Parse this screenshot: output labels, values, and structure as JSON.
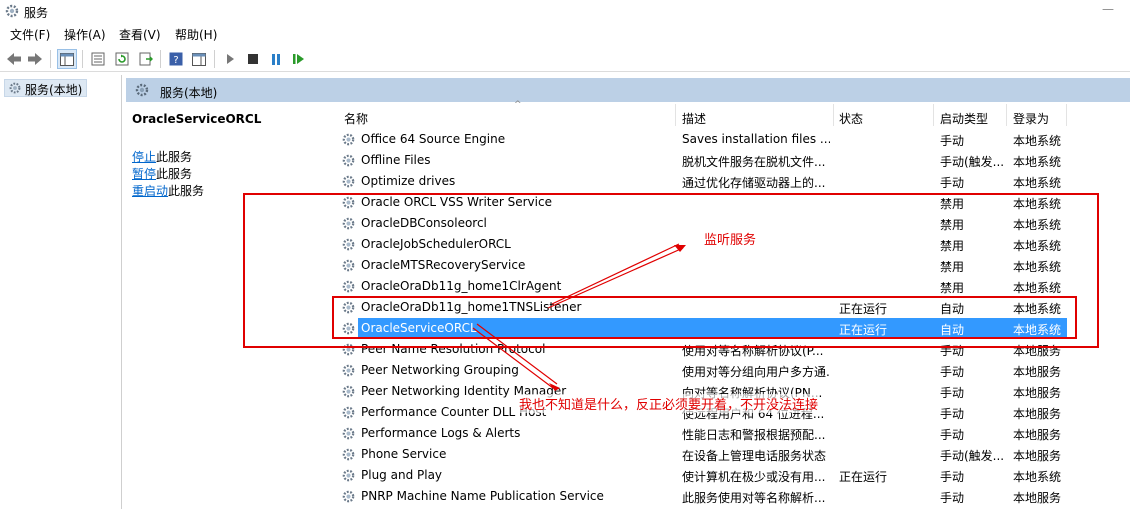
{
  "window": {
    "title": "服务"
  },
  "menu": [
    "文件(F)",
    "操作(A)",
    "查看(V)",
    "帮助(H)"
  ],
  "toolbar": {
    "buttons": [
      "back-icon",
      "forward-icon",
      "show-hide-console-tree-icon",
      "properties-icon",
      "refresh-icon",
      "export-list-icon",
      "help-icon",
      "show-hide-action-pane-icon",
      "start-service-icon",
      "stop-service-icon",
      "pause-service-icon",
      "restart-service-icon"
    ]
  },
  "tree": {
    "node_label": "服务(本地)"
  },
  "content_header": {
    "title": "服务(本地)"
  },
  "extended_panel": {
    "service_name": "OracleServiceORCL",
    "actions": [
      {
        "link": "停止",
        "rest": "此服务"
      },
      {
        "link": "暂停",
        "rest": "此服务"
      },
      {
        "link": "重启动",
        "rest": "此服务"
      }
    ]
  },
  "columns": [
    "名称",
    "描述",
    "状态",
    "启动类型",
    "登录为"
  ],
  "services": [
    {
      "name": "Office 64 Source Engine",
      "description": "Saves installation files ...",
      "status": "",
      "startup": "手动",
      "logon": "本地系统"
    },
    {
      "name": "Offline Files",
      "description": "脱机文件服务在脱机文件...",
      "status": "",
      "startup": "手动(触发...",
      "logon": "本地系统"
    },
    {
      "name": "Optimize drives",
      "description": "通过优化存储驱动器上的...",
      "status": "",
      "startup": "手动",
      "logon": "本地系统"
    },
    {
      "name": "Oracle ORCL VSS Writer Service",
      "description": "",
      "status": "",
      "startup": "禁用",
      "logon": "本地系统"
    },
    {
      "name": "OracleDBConsoleorcl",
      "description": "",
      "status": "",
      "startup": "禁用",
      "logon": "本地系统"
    },
    {
      "name": "OracleJobSchedulerORCL",
      "description": "",
      "status": "",
      "startup": "禁用",
      "logon": "本地系统"
    },
    {
      "name": "OracleMTSRecoveryService",
      "description": "",
      "status": "",
      "startup": "禁用",
      "logon": "本地系统"
    },
    {
      "name": "OracleOraDb11g_home1ClrAgent",
      "description": "",
      "status": "",
      "startup": "禁用",
      "logon": "本地系统"
    },
    {
      "name": "OracleOraDb11g_home1TNSListener",
      "description": "",
      "status": "正在运行",
      "startup": "自动",
      "logon": "本地系统"
    },
    {
      "name": "OracleServiceORCL",
      "description": "",
      "status": "正在运行",
      "startup": "自动",
      "logon": "本地系统",
      "selected": true
    },
    {
      "name": "Peer Name Resolution Protocol",
      "description": "使用对等名称解析协议(P...",
      "status": "",
      "startup": "手动",
      "logon": "本地服务"
    },
    {
      "name": "Peer Networking Grouping",
      "description": "使用对等分组向用户多方通...",
      "status": "",
      "startup": "手动",
      "logon": "本地服务"
    },
    {
      "name": "Peer Networking Identity Manager",
      "description": "向对等名称解析协议(PN...",
      "status": "",
      "startup": "手动",
      "logon": "本地服务"
    },
    {
      "name": "Performance Counter DLL Host",
      "description": "使远程用户和 64 位进程...",
      "status": "",
      "startup": "手动",
      "logon": "本地服务"
    },
    {
      "name": "Performance Logs & Alerts",
      "description": "性能日志和警报根据预配...",
      "status": "",
      "startup": "手动",
      "logon": "本地服务"
    },
    {
      "name": "Phone Service",
      "description": "在设备上管理电话服务状态",
      "status": "",
      "startup": "手动(触发...",
      "logon": "本地服务"
    },
    {
      "name": "Plug and Play",
      "description": "使计算机在极少或没有用...",
      "status": "正在运行",
      "startup": "手动",
      "logon": "本地系统"
    },
    {
      "name": "PNRP Machine Name Publication Service",
      "description": "此服务使用对等名称解析...",
      "status": "",
      "startup": "手动",
      "logon": "本地服务"
    }
  ],
  "annotations": {
    "listener_note": "监听服务",
    "service_note": "我也不知道是什么，反正必须要开着，不开没法连接",
    "color": "#e00000"
  },
  "colors": {
    "selection": "#3399ff",
    "header_bar": "#bcd0e6",
    "link": "#0066cc"
  }
}
